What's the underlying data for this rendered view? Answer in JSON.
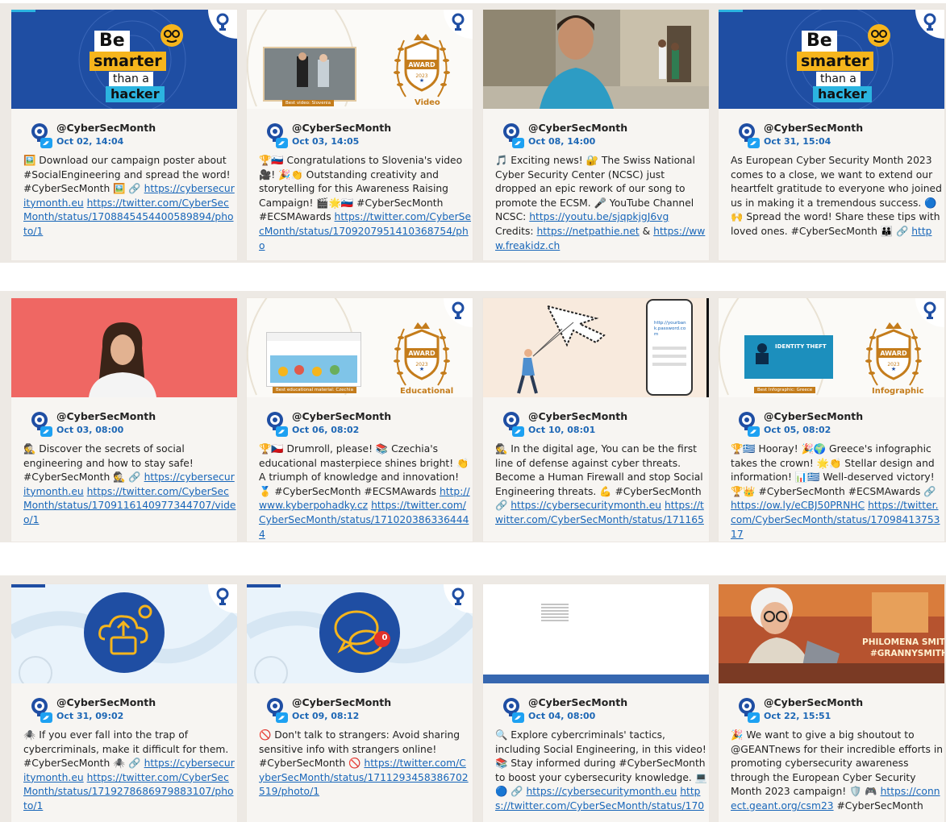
{
  "colors": {
    "band": "#ede9e4",
    "link": "#1866b9",
    "date": "#1d67b5",
    "campaign_blue": "#1f4ea3",
    "award_gold": "#c47c1b"
  },
  "icons": {
    "avatar": "cybersecmonth-bulb-logo",
    "platform": "twitter-bird-icon",
    "stamp": "cybersecmonth-stamp-icon"
  },
  "rows": [
    {
      "cards": [
        {
          "media": {
            "type": "be-smarter",
            "be": "Be",
            "smarter": "smarter",
            "than": "than a",
            "hacker": "hacker"
          },
          "handle": "@CyberSecMonth",
          "date": "Oct 02, 14:04",
          "text": [
            {
              "t": "🖼️"
            },
            {
              "t": " Download our campaign poster about #SocialEngineering and spread the word! #CyberSecMonth "
            },
            {
              "t": "🖼️"
            },
            {
              "t": " 🔗 "
            },
            {
              "link": "https://cybersecuritymonth.eu"
            },
            {
              "t": " "
            },
            {
              "link": "https://twitter.com/CyberSecMonth/status/1708845454400589894/photo/1"
            }
          ]
        },
        {
          "media": {
            "type": "award",
            "badge_top": "AWARD",
            "badge_year": "2023",
            "category": "Video",
            "caption": "Best video: Slovenia"
          },
          "handle": "@CyberSecMonth",
          "date": "Oct 03, 14:05",
          "text": [
            {
              "t": "🏆🇸🇮 Congratulations to Slovenia's video 🎥! 🎉👏 Outstanding creativity and storytelling for this Awareness Raising Campaign! 🎬🌟🇸🇮 #CyberSecMonth #ECSMAwards "
            },
            {
              "link": "https://twitter.com/CyberSecMonth/status/1709207951410368754/pho"
            }
          ]
        },
        {
          "media": {
            "type": "street-photo"
          },
          "handle": "@CyberSecMonth",
          "date": "Oct 08, 14:00",
          "text": [
            {
              "t": "🎵 Exciting news! 🔐 The Swiss National Cyber Security Center (NCSC) just dropped an epic rework of our song to promote the ECSM. 🎤 YouTube Channel NCSC: "
            },
            {
              "link": "https://youtu.be/sjqpkjgJ6vg"
            },
            {
              "t": " Credits: "
            },
            {
              "link": "https://netpathie.net"
            },
            {
              "t": " & "
            },
            {
              "link": "https://www.freakidz.ch"
            }
          ]
        },
        {
          "media": {
            "type": "be-smarter",
            "be": "Be",
            "smarter": "smarter",
            "than": "than a",
            "hacker": "hacker"
          },
          "handle": "@CyberSecMonth",
          "date": "Oct 31, 15:04",
          "text": [
            {
              "t": "As European Cyber Security Month 2023 comes to a close, we want to extend our heartfelt gratitude to everyone who joined us in making it a tremendous success. 🔵🙌 Spread the word! Share these tips with loved ones. #CyberSecMonth 👪 🔗 "
            },
            {
              "link": "http"
            }
          ]
        }
      ]
    },
    {
      "cards": [
        {
          "media": {
            "type": "portrait"
          },
          "handle": "@CyberSecMonth",
          "date": "Oct 03, 08:00",
          "text": [
            {
              "t": "🕵️ Discover the secrets of social engineering and how to stay safe! #CyberSecMonth 🕵️ 🔗 "
            },
            {
              "link": "https://cybersecuritymonth.eu"
            },
            {
              "t": " "
            },
            {
              "link": "https://twitter.com/CyberSecMonth/status/1709116140977344707/video/1"
            }
          ]
        },
        {
          "media": {
            "type": "award-site",
            "badge_top": "AWARD",
            "badge_year": "2023",
            "category": "Educational",
            "caption": "Best educational material: Czechia"
          },
          "handle": "@CyberSecMonth",
          "date": "Oct 06, 08:02",
          "text": [
            {
              "t": "🏆🇨🇿 Drumroll, please! 📚 Czechia's educational masterpiece shines bright! 👏 A triumph of knowledge and innovation! 🥇 #CyberSecMonth #ECSMAwards "
            },
            {
              "link": "http://www.kyberpohadky.cz"
            },
            {
              "t": " "
            },
            {
              "link": "https://twitter.com/CyberSecMonth/status/1710203863364444"
            }
          ]
        },
        {
          "media": {
            "type": "phishing",
            "phone_text": "http://yourbank.password.com"
          },
          "handle": "@CyberSecMonth",
          "date": "Oct 10, 08:01",
          "text": [
            {
              "t": "🕵️ In the digital age, You can be the first line of defense against cyber threats. Become a Human Firewall and stop Social Engineering threats. 💪 #CyberSecMonth 🔗 "
            },
            {
              "link": "https://cybersecuritymonth.eu"
            },
            {
              "t": " "
            },
            {
              "link": "https://twitter.com/CyberSecMonth/status/171165"
            }
          ]
        },
        {
          "media": {
            "type": "award-infographic",
            "badge_top": "AWARD",
            "badge_year": "2023",
            "category": "Infographic",
            "caption": "Best Infographic: Greece",
            "poster_title": "IDENTITY THEFT"
          },
          "handle": "@CyberSecMonth",
          "date": "Oct 05, 08:02",
          "text": [
            {
              "t": "🏆🇬🇷 Hooray! 🎉🌍 Greece's infographic takes the crown! 🌟👏 Stellar design and information! 📊🇬🇷 Well-deserved victory! 🏆👑 #CyberSecMonth #ECSMAwards 🔗 "
            },
            {
              "link": "https://ow.ly/eCBJ50PRNHC"
            },
            {
              "t": " "
            },
            {
              "link": "https://twitter.com/CyberSecMonth/status/1709841375317"
            }
          ]
        }
      ]
    },
    {
      "cards": [
        {
          "media": {
            "type": "circle-cloud"
          },
          "handle": "@CyberSecMonth",
          "date": "Oct 31, 09:02",
          "text": [
            {
              "t": "🕷️ If you ever fall into the trap of cybercriminals, make it difficult for them. #CyberSecMonth 🕷️ 🔗 "
            },
            {
              "link": "https://cybersecuritymonth.eu"
            },
            {
              "t": " "
            },
            {
              "link": "https://twitter.com/CyberSecMonth/status/1719278686979883107/photo/1"
            }
          ]
        },
        {
          "media": {
            "type": "circle-chat",
            "notification": "0"
          },
          "handle": "@CyberSecMonth",
          "date": "Oct 09, 08:12",
          "text": [
            {
              "t": "🚫 Don't talk to strangers: Avoid sharing sensitive info with strangers online! #CyberSecMonth 🚫 "
            },
            {
              "link": "https://twitter.com/CyberSecMonth/status/1711293458386702519/photo/1"
            }
          ]
        },
        {
          "media": {
            "type": "blank-video"
          },
          "handle": "@CyberSecMonth",
          "date": "Oct 04, 08:00",
          "text": [
            {
              "t": "🔍 Explore cybercriminals' tactics, including Social Engineering, in this video! 📚 Stay informed during #CyberSecMonth to boost your cybersecurity knowledge. 💻🔵 🔗 "
            },
            {
              "link": "https://cybersecuritymonth.eu"
            },
            {
              "t": " "
            },
            {
              "link": "https://twitter.com/CyberSecMonth/status/170"
            }
          ]
        },
        {
          "media": {
            "type": "granny",
            "line1": "PHILOMENA SMITH",
            "line2": "#GRANNYSMITHS"
          },
          "handle": "@CyberSecMonth",
          "date": "Oct 22, 15:51",
          "text": [
            {
              "t": "🎉 We want to give a big shoutout to @GEANTnews for their incredible efforts in promoting cybersecurity awareness through the European Cyber Security Month 2023 campaign! 🛡️ 🎮 "
            },
            {
              "link": "https://connect.geant.org/csm23"
            },
            {
              "t": " #CyberSecMonth"
            }
          ]
        }
      ]
    }
  ]
}
